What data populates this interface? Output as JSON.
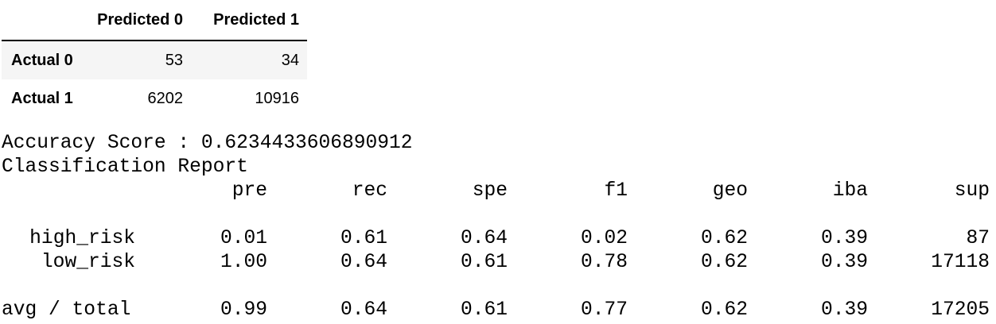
{
  "confusion_matrix": {
    "columns": [
      "Predicted 0",
      "Predicted 1"
    ],
    "rows": [
      {
        "label": "Actual 0",
        "values": [
          "53",
          "34"
        ]
      },
      {
        "label": "Actual 1",
        "values": [
          "6202",
          "10916"
        ]
      }
    ]
  },
  "accuracy_line": "Accuracy Score : 0.6234433606890912",
  "report_title": "Classification Report",
  "report": {
    "headers": [
      "pre",
      "rec",
      "spe",
      "f1",
      "geo",
      "iba",
      "sup"
    ],
    "rows": [
      {
        "label": "high_risk",
        "values": [
          "0.01",
          "0.61",
          "0.64",
          "0.02",
          "0.62",
          "0.39",
          "87"
        ]
      },
      {
        "label": "low_risk",
        "values": [
          "1.00",
          "0.64",
          "0.61",
          "0.78",
          "0.62",
          "0.39",
          "17118"
        ]
      }
    ],
    "total": {
      "label": "avg / total",
      "values": [
        "0.99",
        "0.64",
        "0.61",
        "0.77",
        "0.62",
        "0.39",
        "17205"
      ]
    }
  }
}
